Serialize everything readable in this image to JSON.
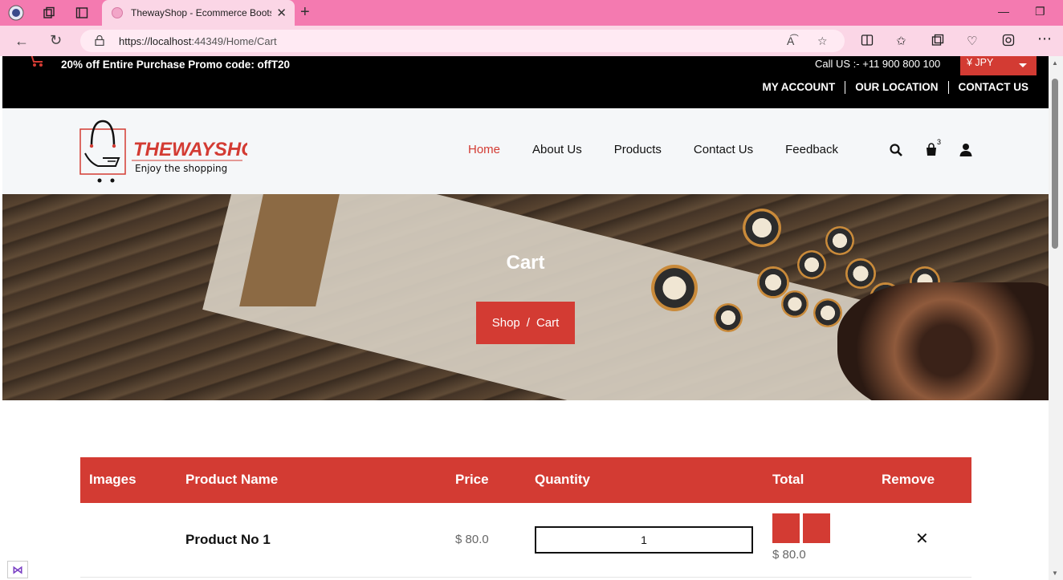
{
  "browser": {
    "tab_title": "ThewayShop - Ecommerce Bootstrap",
    "url_host": "https://localhost",
    "url_path": ":44349/Home/Cart"
  },
  "topbar": {
    "promo": "20% off Entire Purchase Promo code: offT20",
    "call": "Call US :- +11 900 800 100",
    "currency": "¥ JPY",
    "links": [
      "MY ACCOUNT",
      "OUR LOCATION",
      "CONTACT US"
    ]
  },
  "logo": {
    "brand": "THEWAYSHOP",
    "tagline": "Enjoy the shopping"
  },
  "nav": {
    "items": [
      "Home",
      "About Us",
      "Products",
      "Contact Us",
      "Feedback"
    ],
    "active": "Home",
    "cart_count": "3"
  },
  "banner": {
    "title": "Cart",
    "crumb_shop": "Shop",
    "crumb_sep": "/",
    "crumb_current": "Cart"
  },
  "cart": {
    "headers": [
      "Images",
      "Product Name",
      "Price",
      "Quantity",
      "Total",
      "Remove"
    ],
    "rows": [
      {
        "name": "Product No 1",
        "price": "$ 80.0",
        "quantity": "1",
        "total": "$ 80.0",
        "remove": "✕"
      }
    ]
  },
  "colors": {
    "accent": "#d33b33",
    "tab_bar": "#f47ab0",
    "topbar": "#000000"
  }
}
